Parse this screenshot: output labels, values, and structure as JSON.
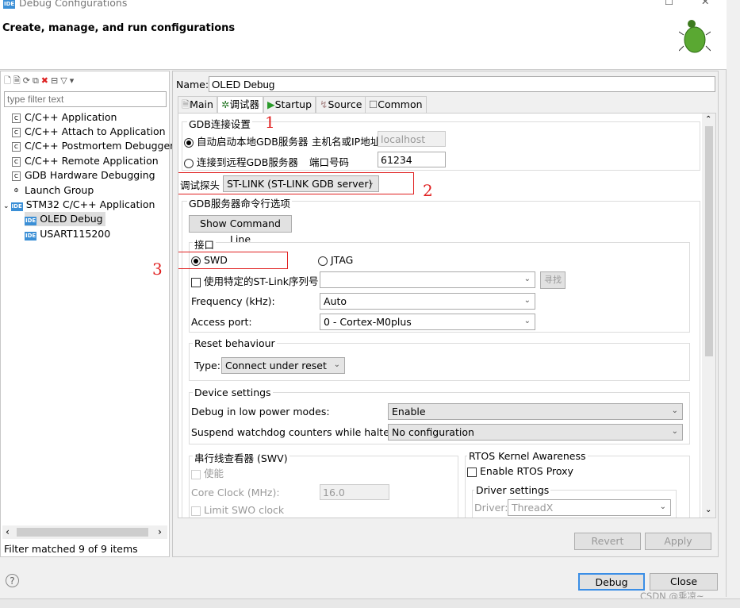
{
  "window": {
    "title": "Debug Configurations",
    "banner_title": "Create, manage, and run configurations"
  },
  "left": {
    "filter_placeholder": "type filter text",
    "status": "Filter matched 9 of 9 items",
    "items": [
      {
        "label": "C/C++ Application"
      },
      {
        "label": "C/C++ Attach to Application"
      },
      {
        "label": "C/C++ Postmortem Debugger"
      },
      {
        "label": "C/C++ Remote Application"
      },
      {
        "label": "GDB Hardware Debugging"
      },
      {
        "label": "Launch Group"
      },
      {
        "label": "STM32 C/C++ Application"
      },
      {
        "label": "OLED Debug"
      },
      {
        "label": "USART115200"
      }
    ]
  },
  "main": {
    "name_label": "Name:",
    "name_value": "OLED Debug",
    "tabs": [
      {
        "label": "Main"
      },
      {
        "label": "调试器"
      },
      {
        "label": "Startup"
      },
      {
        "label": "Source"
      },
      {
        "label": "Common"
      }
    ],
    "gdb_group": "GDB连接设置",
    "auto_start": "自动启动本地GDB服务器",
    "host_label": "主机名或IP地址",
    "host_value": "localhost",
    "remote": "连接到远程GDB服务器",
    "port_label": "端口号码",
    "port_value": "61234",
    "probe_label": "调试探头",
    "probe_value": "ST-LINK (ST-LINK GDB server)",
    "cmd_group": "GDB服务器命令行选项",
    "show_cmd": "Show Command Line",
    "iface_group": "接口",
    "swd": "SWD",
    "jtag": "JTAG",
    "use_serial": "使用特定的ST-Link序列号",
    "find": "寻找",
    "freq_label": "Frequency (kHz):",
    "freq_value": "Auto",
    "ap_label": "Access port:",
    "ap_value": "0 - Cortex-M0plus",
    "reset_group": "Reset behaviour",
    "type_label": "Type:",
    "type_value": "Connect under reset",
    "device_group": "Device settings",
    "lowpower_label": "Debug in low power modes:",
    "lowpower_value": "Enable",
    "wd_label": "Suspend watchdog counters while halted:",
    "wd_value": "No configuration",
    "swv_group": "串行线查看器 (SWV)",
    "swv_enable": "使能",
    "core_clock_label": "Core Clock (MHz):",
    "core_clock_value": "16.0",
    "limit_swo": "Limit SWO clock",
    "rtos_group": "RTOS Kernel Awareness",
    "rtos_proxy": "Enable RTOS Proxy",
    "driver_group": "Driver settings",
    "driver_label": "Driver:",
    "driver_value": "ThreadX",
    "revert": "Revert",
    "apply": "Apply"
  },
  "footer": {
    "debug": "Debug",
    "close": "Close",
    "watermark": "CSDN @乘凉~"
  },
  "annotations": {
    "a1": "1",
    "a2": "2",
    "a3": "3"
  }
}
